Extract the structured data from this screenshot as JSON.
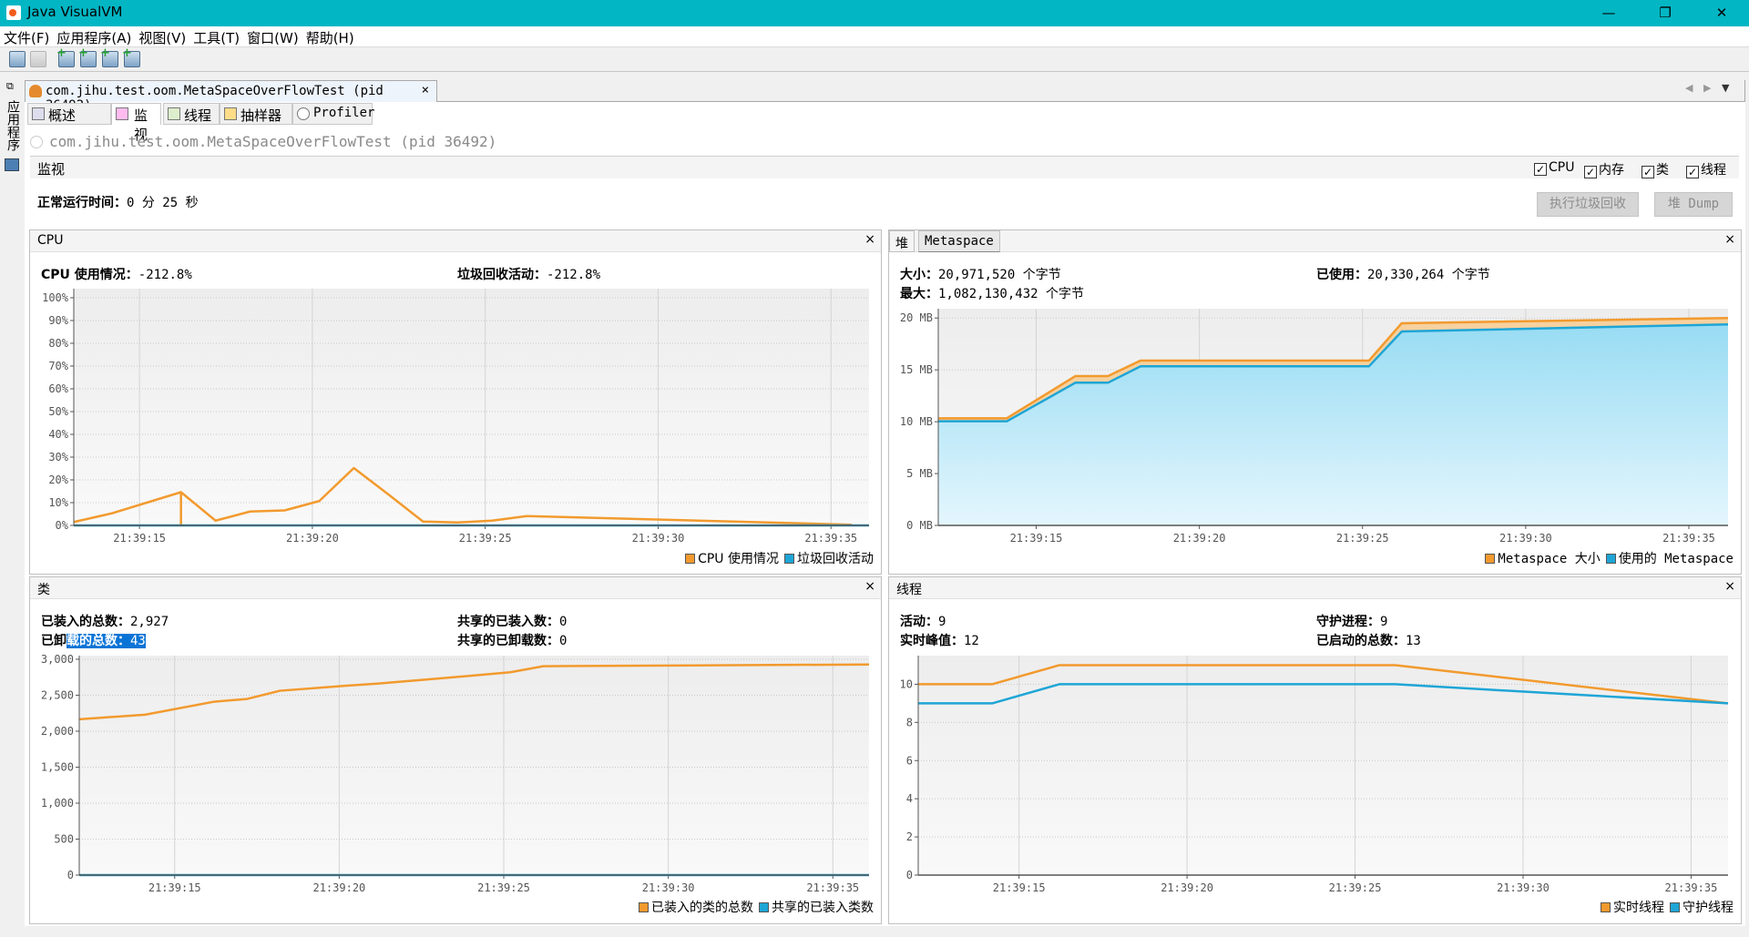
{
  "window": {
    "title": "Java VisualVM",
    "controls": {
      "minimize": "—",
      "maximize": "❐",
      "close": "✕"
    }
  },
  "menu": [
    "文件(F)",
    "应用程序(A)",
    "视图(V)",
    "工具(T)",
    "窗口(W)",
    "帮助(H)"
  ],
  "toolbar": {
    "icons": [
      "open-icon",
      "save-icon",
      "add-remote-host-icon",
      "add-jmx-connection-icon",
      "add-snapshot-icon",
      "add-core-dump-icon"
    ]
  },
  "sidebar": {
    "label": "应用程序"
  },
  "document_tab": {
    "title": "com.jihu.test.oom.MetaSpaceOverFlowTest (pid 36492)",
    "close": "×"
  },
  "subtabs": [
    {
      "label": "概述"
    },
    {
      "label": "监视"
    },
    {
      "label": "线程"
    },
    {
      "label": "抽样器"
    },
    {
      "label": "Profiler"
    }
  ],
  "app": {
    "name": "com.jihu.test.oom.MetaSpaceOverFlowTest",
    "pid": "(pid 36492)"
  },
  "monitor": {
    "title": "监视",
    "checkboxes": [
      {
        "label": "CPU",
        "checked": true
      },
      {
        "label": "内存",
        "checked": true
      },
      {
        "label": "类",
        "checked": true
      },
      {
        "label": "线程",
        "checked": true
      }
    ],
    "uptime_label": "正常运行时间：",
    "uptime_value": "0 分 25 秒",
    "gc_button": "执行垃圾回收",
    "heap_dump_button": "堆 Dump"
  },
  "cpu": {
    "title": "CPU",
    "close": "×",
    "usage_label": "CPU 使用情况：",
    "usage_value": "-212.8%",
    "gc_label": "垃圾回收活动：",
    "gc_value": "-212.8%"
  },
  "memory": {
    "tabs": [
      "堆",
      "Metaspace"
    ],
    "close": "×",
    "size_label": "大小：",
    "size_value": "20,971,520 个字节",
    "used_label": "已使用：",
    "used_value": "20,330,264 个字节",
    "max_label": "最大：",
    "max_value": "1,082,130,432 个字节"
  },
  "classes": {
    "title": "类",
    "close": "×",
    "loaded_label": "已装入的总数：",
    "loaded_value": "2,927",
    "unloaded_label_a": "已卸",
    "unloaded_label_b": "载的总数：",
    "unloaded_value": "43",
    "shared_loaded_label": "共享的已装入数：",
    "shared_loaded_value": "0",
    "shared_unloaded_label": "共享的已卸载数：",
    "shared_unloaded_value": "0"
  },
  "threads": {
    "title": "线程",
    "close": "×",
    "live_label": "活动：",
    "live_value": "9",
    "daemon_label": "守护进程：",
    "daemon_value": "9",
    "peak_label": "实时峰值：",
    "peak_value": "12",
    "started_label": "已启动的总数：",
    "started_value": "13"
  },
  "colors": {
    "orange": "#f29a2e",
    "blue": "#1ea5d6",
    "titlebar": "#03b6c4"
  },
  "chart_data": [
    {
      "type": "line",
      "xlim": [
        "21:39:13.1",
        "21:39:36.1"
      ],
      "ylim": [
        0,
        104
      ],
      "x_ticks": [
        "21:39:15",
        "21:39:20",
        "21:39:25",
        "21:39:30",
        "21:39:35"
      ],
      "y_ticks": [
        {
          "v": 0,
          "l": "0%"
        },
        {
          "v": 10,
          "l": "10%"
        },
        {
          "v": 20,
          "l": "20%"
        },
        {
          "v": 30,
          "l": "30%"
        },
        {
          "v": 40,
          "l": "40%"
        },
        {
          "v": 50,
          "l": "50%"
        },
        {
          "v": 60,
          "l": "60%"
        },
        {
          "v": 70,
          "l": "70%"
        },
        {
          "v": 80,
          "l": "80%"
        },
        {
          "v": 90,
          "l": "90%"
        },
        {
          "v": 100,
          "l": "100%"
        }
      ],
      "legend": "bottom-right",
      "series": [
        {
          "name": "CPU 使用情况",
          "color": "#f29a2e",
          "points": [
            [
              "21:39:13.1",
              1.5
            ],
            [
              "21:39:14.2",
              5.3
            ],
            [
              "21:39:16.2",
              14.6
            ],
            [
              "21:39:16.2",
              0
            ],
            [
              "21:39:16.2",
              14.6
            ],
            [
              "21:39:17.2",
              2.1
            ],
            [
              "21:39:18.2",
              6.1
            ],
            [
              "21:39:19.2",
              6.6
            ],
            [
              "21:39:20.2",
              10.7
            ],
            [
              "21:39:21.2",
              25.2
            ],
            [
              "21:39:22.2",
              13.6
            ],
            [
              "21:39:23.2",
              1.7
            ],
            [
              "21:39:24.2",
              1.3
            ],
            [
              "21:39:25.2",
              2.1
            ],
            [
              "21:39:26.2",
              4.1
            ],
            [
              "21:39:35.6",
              0.3
            ]
          ]
        },
        {
          "name": "垃圾回收活动",
          "color": "#1ea5d6",
          "points": [
            [
              "21:39:13.1",
              0
            ],
            [
              "21:39:36.1",
              0
            ]
          ]
        }
      ]
    },
    {
      "type": "area",
      "xlim": [
        "21:39:12.0",
        "21:39:36.2"
      ],
      "ylim": [
        0,
        20.9
      ],
      "x_ticks": [
        "21:39:15",
        "21:39:20",
        "21:39:25",
        "21:39:30",
        "21:39:35"
      ],
      "y_ticks": [
        {
          "v": 0,
          "l": "0 MB"
        },
        {
          "v": 5,
          "l": "5 MB"
        },
        {
          "v": 10,
          "l": "10 MB"
        },
        {
          "v": 15,
          "l": "15 MB"
        },
        {
          "v": 20,
          "l": "20 MB"
        }
      ],
      "legend": "bottom-right",
      "series": [
        {
          "name": "Metaspace 大小",
          "color": "#f29a2e",
          "fill": "#f7d19f",
          "points": [
            [
              "21:39:12.0",
              10.33
            ],
            [
              "21:39:14.1",
              10.33
            ],
            [
              "21:39:16.2",
              14.4
            ],
            [
              "21:39:17.2",
              14.4
            ],
            [
              "21:39:18.2",
              15.9
            ],
            [
              "21:39:25.2",
              15.9
            ],
            [
              "21:39:26.2",
              19.5
            ],
            [
              "21:39:36.2",
              20.0
            ]
          ]
        },
        {
          "name": "使用的 Metaspace",
          "color": "#1ea5d6",
          "fill": "url(#blueGrad)",
          "points": [
            [
              "21:39:12.0",
              10.04
            ],
            [
              "21:39:14.1",
              10.04
            ],
            [
              "21:39:16.2",
              13.76
            ],
            [
              "21:39:17.2",
              13.76
            ],
            [
              "21:39:18.2",
              15.35
            ],
            [
              "21:39:25.2",
              15.35
            ],
            [
              "21:39:26.2",
              18.7
            ],
            [
              "21:39:36.2",
              19.39
            ]
          ]
        }
      ]
    },
    {
      "type": "line",
      "xlim": [
        "21:39:12.1",
        "21:39:36.1"
      ],
      "ylim": [
        0,
        3050
      ],
      "x_ticks": [
        "21:39:15",
        "21:39:20",
        "21:39:25",
        "21:39:30",
        "21:39:35"
      ],
      "y_ticks": [
        {
          "v": 0,
          "l": "0"
        },
        {
          "v": 500,
          "l": "500"
        },
        {
          "v": 1000,
          "l": "1,000"
        },
        {
          "v": 1500,
          "l": "1,500"
        },
        {
          "v": 2000,
          "l": "2,000"
        },
        {
          "v": 2500,
          "l": "2,500"
        },
        {
          "v": 3000,
          "l": "3,000"
        }
      ],
      "legend": "bottom-right",
      "series": [
        {
          "name": "已装入的类的总数",
          "color": "#f29a2e",
          "points": [
            [
              "21:39:12.1",
              2166
            ],
            [
              "21:39:14.1",
              2229
            ],
            [
              "21:39:16.2",
              2410
            ],
            [
              "21:39:17.2",
              2448
            ],
            [
              "21:39:18.2",
              2562
            ],
            [
              "21:39:20.0",
              2625
            ],
            [
              "21:39:21.2",
              2663
            ],
            [
              "21:39:23.1",
              2735
            ],
            [
              "21:39:25.2",
              2819
            ],
            [
              "21:39:26.2",
              2903
            ],
            [
              "21:39:36.1",
              2927
            ]
          ]
        },
        {
          "name": "共享的已装入类数",
          "color": "#1ea5d6",
          "points": [
            [
              "21:39:12.1",
              0
            ],
            [
              "21:39:36.1",
              0
            ]
          ]
        }
      ]
    },
    {
      "type": "line",
      "xlim": [
        "21:39:12.0",
        "21:39:36.1"
      ],
      "ylim": [
        0,
        11.5
      ],
      "x_ticks": [
        "21:39:15",
        "21:39:20",
        "21:39:25",
        "21:39:30",
        "21:39:35"
      ],
      "y_ticks": [
        {
          "v": 0,
          "l": "0"
        },
        {
          "v": 2,
          "l": "2"
        },
        {
          "v": 4,
          "l": "4"
        },
        {
          "v": 6,
          "l": "6"
        },
        {
          "v": 8,
          "l": "8"
        },
        {
          "v": 10,
          "l": "10"
        }
      ],
      "legend": "bottom-right",
      "series": [
        {
          "name": "实时线程",
          "color": "#f29a2e",
          "points": [
            [
              "21:39:12.0",
              10
            ],
            [
              "21:39:14.2",
              10
            ],
            [
              "21:39:16.2",
              11
            ],
            [
              "21:39:26.2",
              11
            ],
            [
              "21:39:36.1",
              9
            ]
          ]
        },
        {
          "name": "守护线程",
          "color": "#1ea5d6",
          "points": [
            [
              "21:39:12.0",
              9
            ],
            [
              "21:39:14.2",
              9
            ],
            [
              "21:39:16.2",
              10
            ],
            [
              "21:39:26.2",
              10
            ],
            [
              "21:39:36.1",
              9
            ]
          ]
        }
      ]
    }
  ]
}
